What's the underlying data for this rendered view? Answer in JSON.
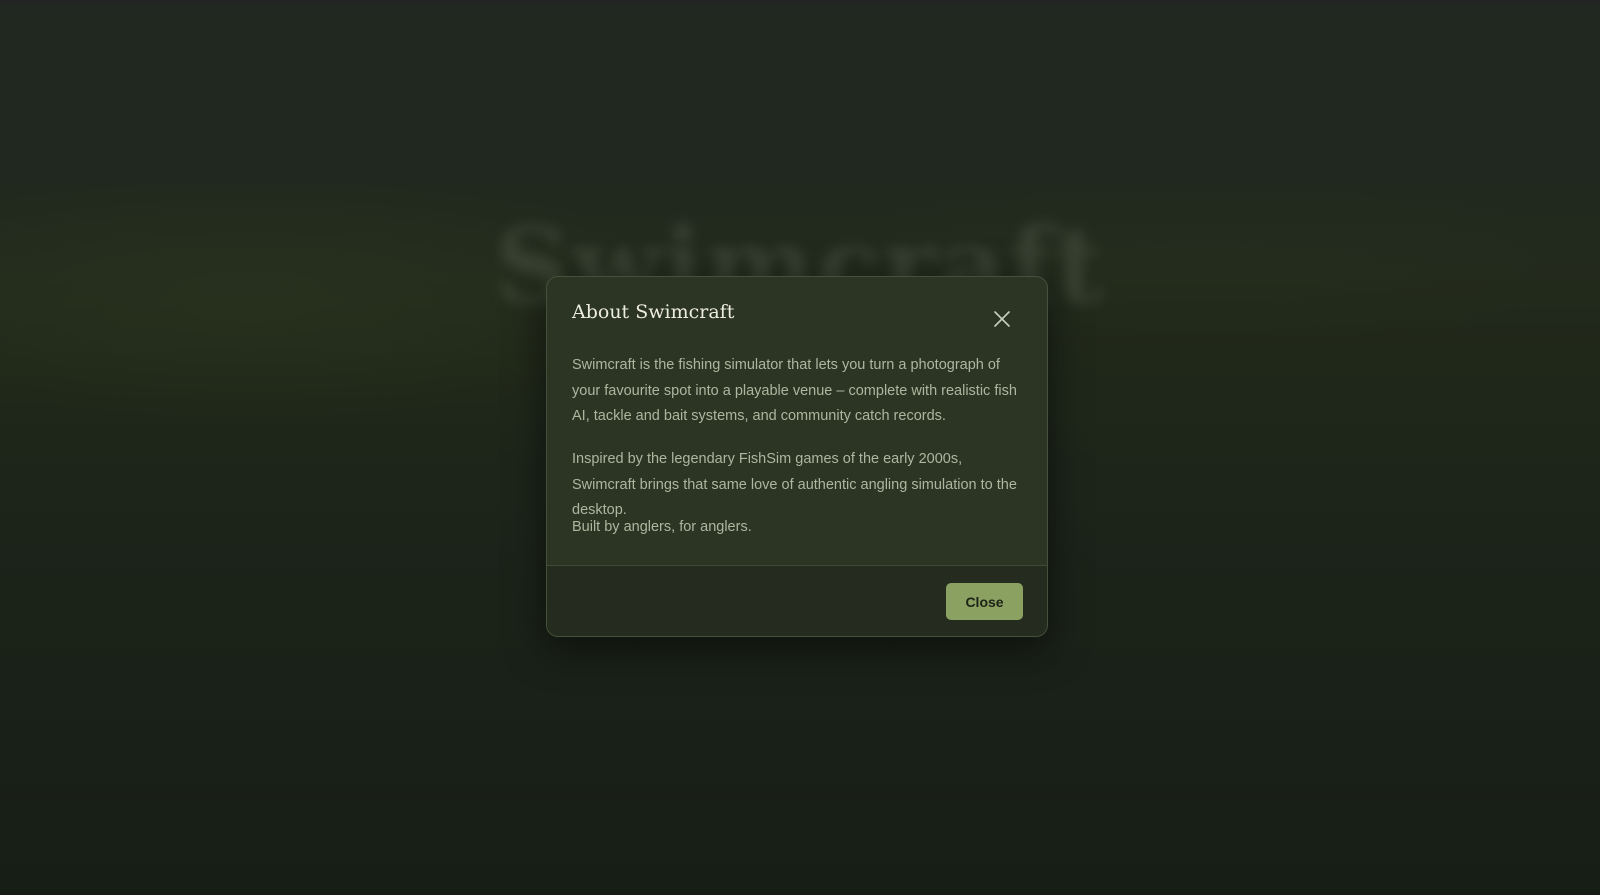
{
  "background": {
    "hero_title": "Swimcraft"
  },
  "dialog": {
    "title": "About Swimcraft",
    "close_icon": "close-x-icon",
    "paragraphs": [
      "Swimcraft is the fishing simulator that lets you turn a photograph of your favourite spot into a playable venue – complete with realistic fish AI, tackle and bait systems, and community catch records.",
      "Inspired by the legendary FishSim games of the early 2000s, Swimcraft brings that same love of authentic angling simulation to the desktop.",
      "Built by anglers, for anglers."
    ],
    "close_button_label": "Close"
  },
  "colors": {
    "accent": "#8aa161",
    "dialog_bg": "#2c3424",
    "footer_bg": "#252b1e",
    "page_bg": "#1c231a"
  }
}
